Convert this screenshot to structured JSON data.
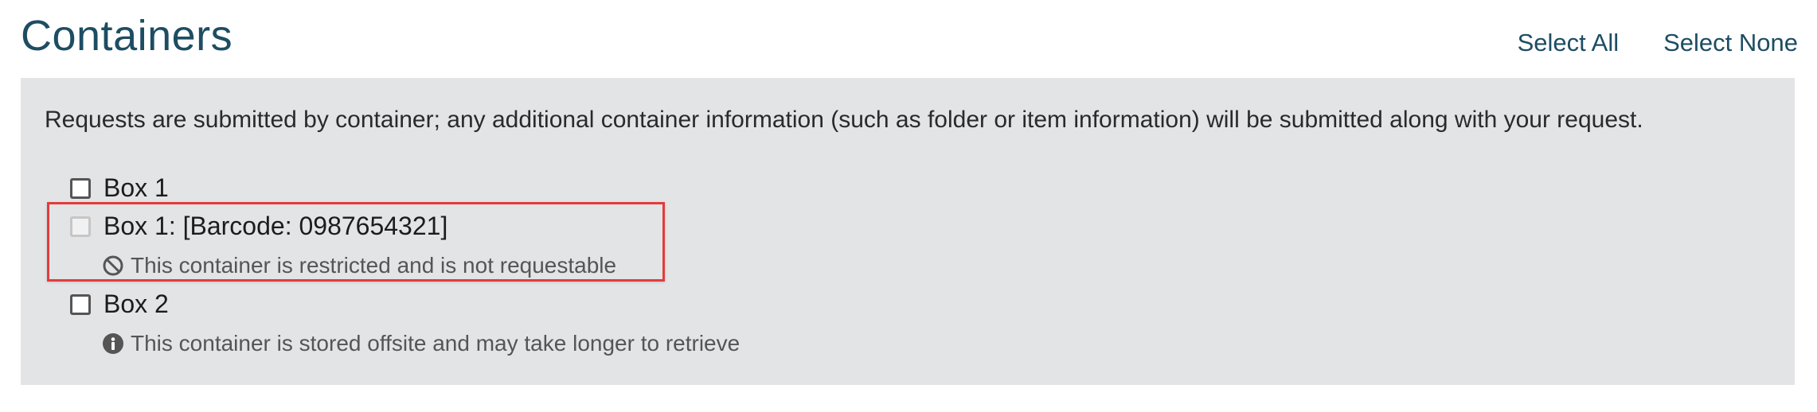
{
  "page": {
    "title": "Containers"
  },
  "actions": {
    "select_all": "Select All",
    "select_none": "Select None"
  },
  "panel": {
    "intro": "Requests are submitted by container; any additional container information (such as folder or item information) will be submitted along with your request.",
    "containers": [
      {
        "label": "Box 1",
        "checked": false,
        "disabled": false
      },
      {
        "label": "Box 1: [Barcode: 0987654321]",
        "checked": false,
        "disabled": true,
        "note_icon": "ban-icon",
        "note": "This container is restricted and is not requestable"
      },
      {
        "label": "Box 2",
        "checked": false,
        "disabled": false,
        "note_icon": "info-icon",
        "note": "This container is stored offsite and may take longer to retrieve"
      }
    ]
  },
  "colors": {
    "title": "#1d4d63",
    "panel_bg": "#e3e4e6",
    "highlight": "#e23c3c"
  }
}
